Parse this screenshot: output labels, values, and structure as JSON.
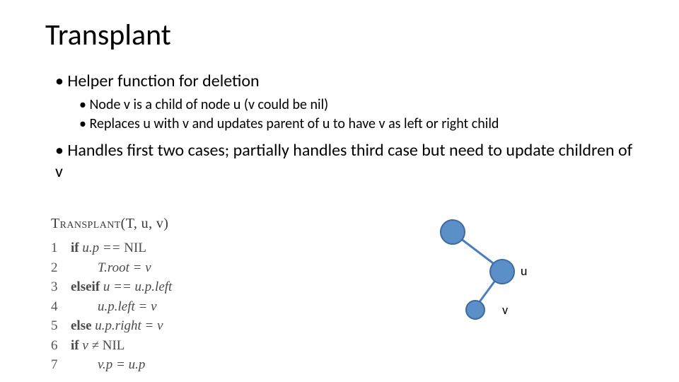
{
  "title": "Transplant",
  "bullets": {
    "b1": "Helper function for deletion",
    "sub1": "Node v is a child of node u  (v could be nil)",
    "sub2": "Replaces u with v and updates parent of u to have v as left or right child",
    "b2": "Handles first two cases; partially handles third case but need to update children of v"
  },
  "pseudo": {
    "fn_name": "Transplant",
    "fn_args": "(T, u, v)",
    "lines": [
      {
        "n": "1",
        "kw": "if ",
        "code": "u.p == ",
        "tail": "NIL",
        "indent": 0
      },
      {
        "n": "2",
        "kw": "",
        "code": "T.root  =  v",
        "tail": "",
        "indent": 1
      },
      {
        "n": "3",
        "kw": "elseif ",
        "code": "u  ==  u.p.left",
        "tail": "",
        "indent": 0
      },
      {
        "n": "4",
        "kw": "",
        "code": "u.p.left  =  v",
        "tail": "",
        "indent": 1
      },
      {
        "n": "5",
        "kw": "else ",
        "code": "u.p.right  =  v",
        "tail": "",
        "indent": 0
      },
      {
        "n": "6",
        "kw": "if ",
        "code": "v  ≠  ",
        "tail": "NIL",
        "indent": 0
      },
      {
        "n": "7",
        "kw": "",
        "code": "v.p  =  u.p",
        "tail": "",
        "indent": 1
      }
    ]
  },
  "diagram": {
    "label_u": "u",
    "label_v": "v"
  }
}
